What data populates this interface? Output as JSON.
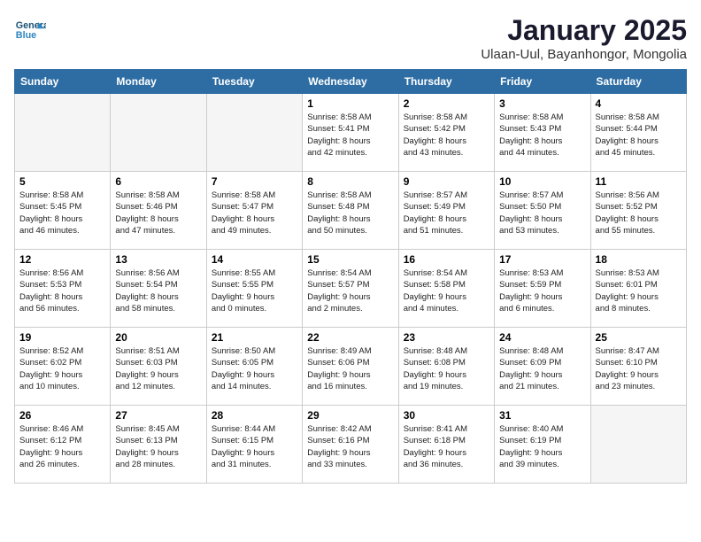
{
  "header": {
    "logo_line1": "General",
    "logo_line2": "Blue",
    "title": "January 2025",
    "subtitle": "Ulaan-Uul, Bayanhongor, Mongolia"
  },
  "days_of_week": [
    "Sunday",
    "Monday",
    "Tuesday",
    "Wednesday",
    "Thursday",
    "Friday",
    "Saturday"
  ],
  "weeks": [
    [
      {
        "day": "",
        "detail": ""
      },
      {
        "day": "",
        "detail": ""
      },
      {
        "day": "",
        "detail": ""
      },
      {
        "day": "1",
        "detail": "Sunrise: 8:58 AM\nSunset: 5:41 PM\nDaylight: 8 hours\nand 42 minutes."
      },
      {
        "day": "2",
        "detail": "Sunrise: 8:58 AM\nSunset: 5:42 PM\nDaylight: 8 hours\nand 43 minutes."
      },
      {
        "day": "3",
        "detail": "Sunrise: 8:58 AM\nSunset: 5:43 PM\nDaylight: 8 hours\nand 44 minutes."
      },
      {
        "day": "4",
        "detail": "Sunrise: 8:58 AM\nSunset: 5:44 PM\nDaylight: 8 hours\nand 45 minutes."
      }
    ],
    [
      {
        "day": "5",
        "detail": "Sunrise: 8:58 AM\nSunset: 5:45 PM\nDaylight: 8 hours\nand 46 minutes."
      },
      {
        "day": "6",
        "detail": "Sunrise: 8:58 AM\nSunset: 5:46 PM\nDaylight: 8 hours\nand 47 minutes."
      },
      {
        "day": "7",
        "detail": "Sunrise: 8:58 AM\nSunset: 5:47 PM\nDaylight: 8 hours\nand 49 minutes."
      },
      {
        "day": "8",
        "detail": "Sunrise: 8:58 AM\nSunset: 5:48 PM\nDaylight: 8 hours\nand 50 minutes."
      },
      {
        "day": "9",
        "detail": "Sunrise: 8:57 AM\nSunset: 5:49 PM\nDaylight: 8 hours\nand 51 minutes."
      },
      {
        "day": "10",
        "detail": "Sunrise: 8:57 AM\nSunset: 5:50 PM\nDaylight: 8 hours\nand 53 minutes."
      },
      {
        "day": "11",
        "detail": "Sunrise: 8:56 AM\nSunset: 5:52 PM\nDaylight: 8 hours\nand 55 minutes."
      }
    ],
    [
      {
        "day": "12",
        "detail": "Sunrise: 8:56 AM\nSunset: 5:53 PM\nDaylight: 8 hours\nand 56 minutes."
      },
      {
        "day": "13",
        "detail": "Sunrise: 8:56 AM\nSunset: 5:54 PM\nDaylight: 8 hours\nand 58 minutes."
      },
      {
        "day": "14",
        "detail": "Sunrise: 8:55 AM\nSunset: 5:55 PM\nDaylight: 9 hours\nand 0 minutes."
      },
      {
        "day": "15",
        "detail": "Sunrise: 8:54 AM\nSunset: 5:57 PM\nDaylight: 9 hours\nand 2 minutes."
      },
      {
        "day": "16",
        "detail": "Sunrise: 8:54 AM\nSunset: 5:58 PM\nDaylight: 9 hours\nand 4 minutes."
      },
      {
        "day": "17",
        "detail": "Sunrise: 8:53 AM\nSunset: 5:59 PM\nDaylight: 9 hours\nand 6 minutes."
      },
      {
        "day": "18",
        "detail": "Sunrise: 8:53 AM\nSunset: 6:01 PM\nDaylight: 9 hours\nand 8 minutes."
      }
    ],
    [
      {
        "day": "19",
        "detail": "Sunrise: 8:52 AM\nSunset: 6:02 PM\nDaylight: 9 hours\nand 10 minutes."
      },
      {
        "day": "20",
        "detail": "Sunrise: 8:51 AM\nSunset: 6:03 PM\nDaylight: 9 hours\nand 12 minutes."
      },
      {
        "day": "21",
        "detail": "Sunrise: 8:50 AM\nSunset: 6:05 PM\nDaylight: 9 hours\nand 14 minutes."
      },
      {
        "day": "22",
        "detail": "Sunrise: 8:49 AM\nSunset: 6:06 PM\nDaylight: 9 hours\nand 16 minutes."
      },
      {
        "day": "23",
        "detail": "Sunrise: 8:48 AM\nSunset: 6:08 PM\nDaylight: 9 hours\nand 19 minutes."
      },
      {
        "day": "24",
        "detail": "Sunrise: 8:48 AM\nSunset: 6:09 PM\nDaylight: 9 hours\nand 21 minutes."
      },
      {
        "day": "25",
        "detail": "Sunrise: 8:47 AM\nSunset: 6:10 PM\nDaylight: 9 hours\nand 23 minutes."
      }
    ],
    [
      {
        "day": "26",
        "detail": "Sunrise: 8:46 AM\nSunset: 6:12 PM\nDaylight: 9 hours\nand 26 minutes."
      },
      {
        "day": "27",
        "detail": "Sunrise: 8:45 AM\nSunset: 6:13 PM\nDaylight: 9 hours\nand 28 minutes."
      },
      {
        "day": "28",
        "detail": "Sunrise: 8:44 AM\nSunset: 6:15 PM\nDaylight: 9 hours\nand 31 minutes."
      },
      {
        "day": "29",
        "detail": "Sunrise: 8:42 AM\nSunset: 6:16 PM\nDaylight: 9 hours\nand 33 minutes."
      },
      {
        "day": "30",
        "detail": "Sunrise: 8:41 AM\nSunset: 6:18 PM\nDaylight: 9 hours\nand 36 minutes."
      },
      {
        "day": "31",
        "detail": "Sunrise: 8:40 AM\nSunset: 6:19 PM\nDaylight: 9 hours\nand 39 minutes."
      },
      {
        "day": "",
        "detail": ""
      }
    ]
  ]
}
